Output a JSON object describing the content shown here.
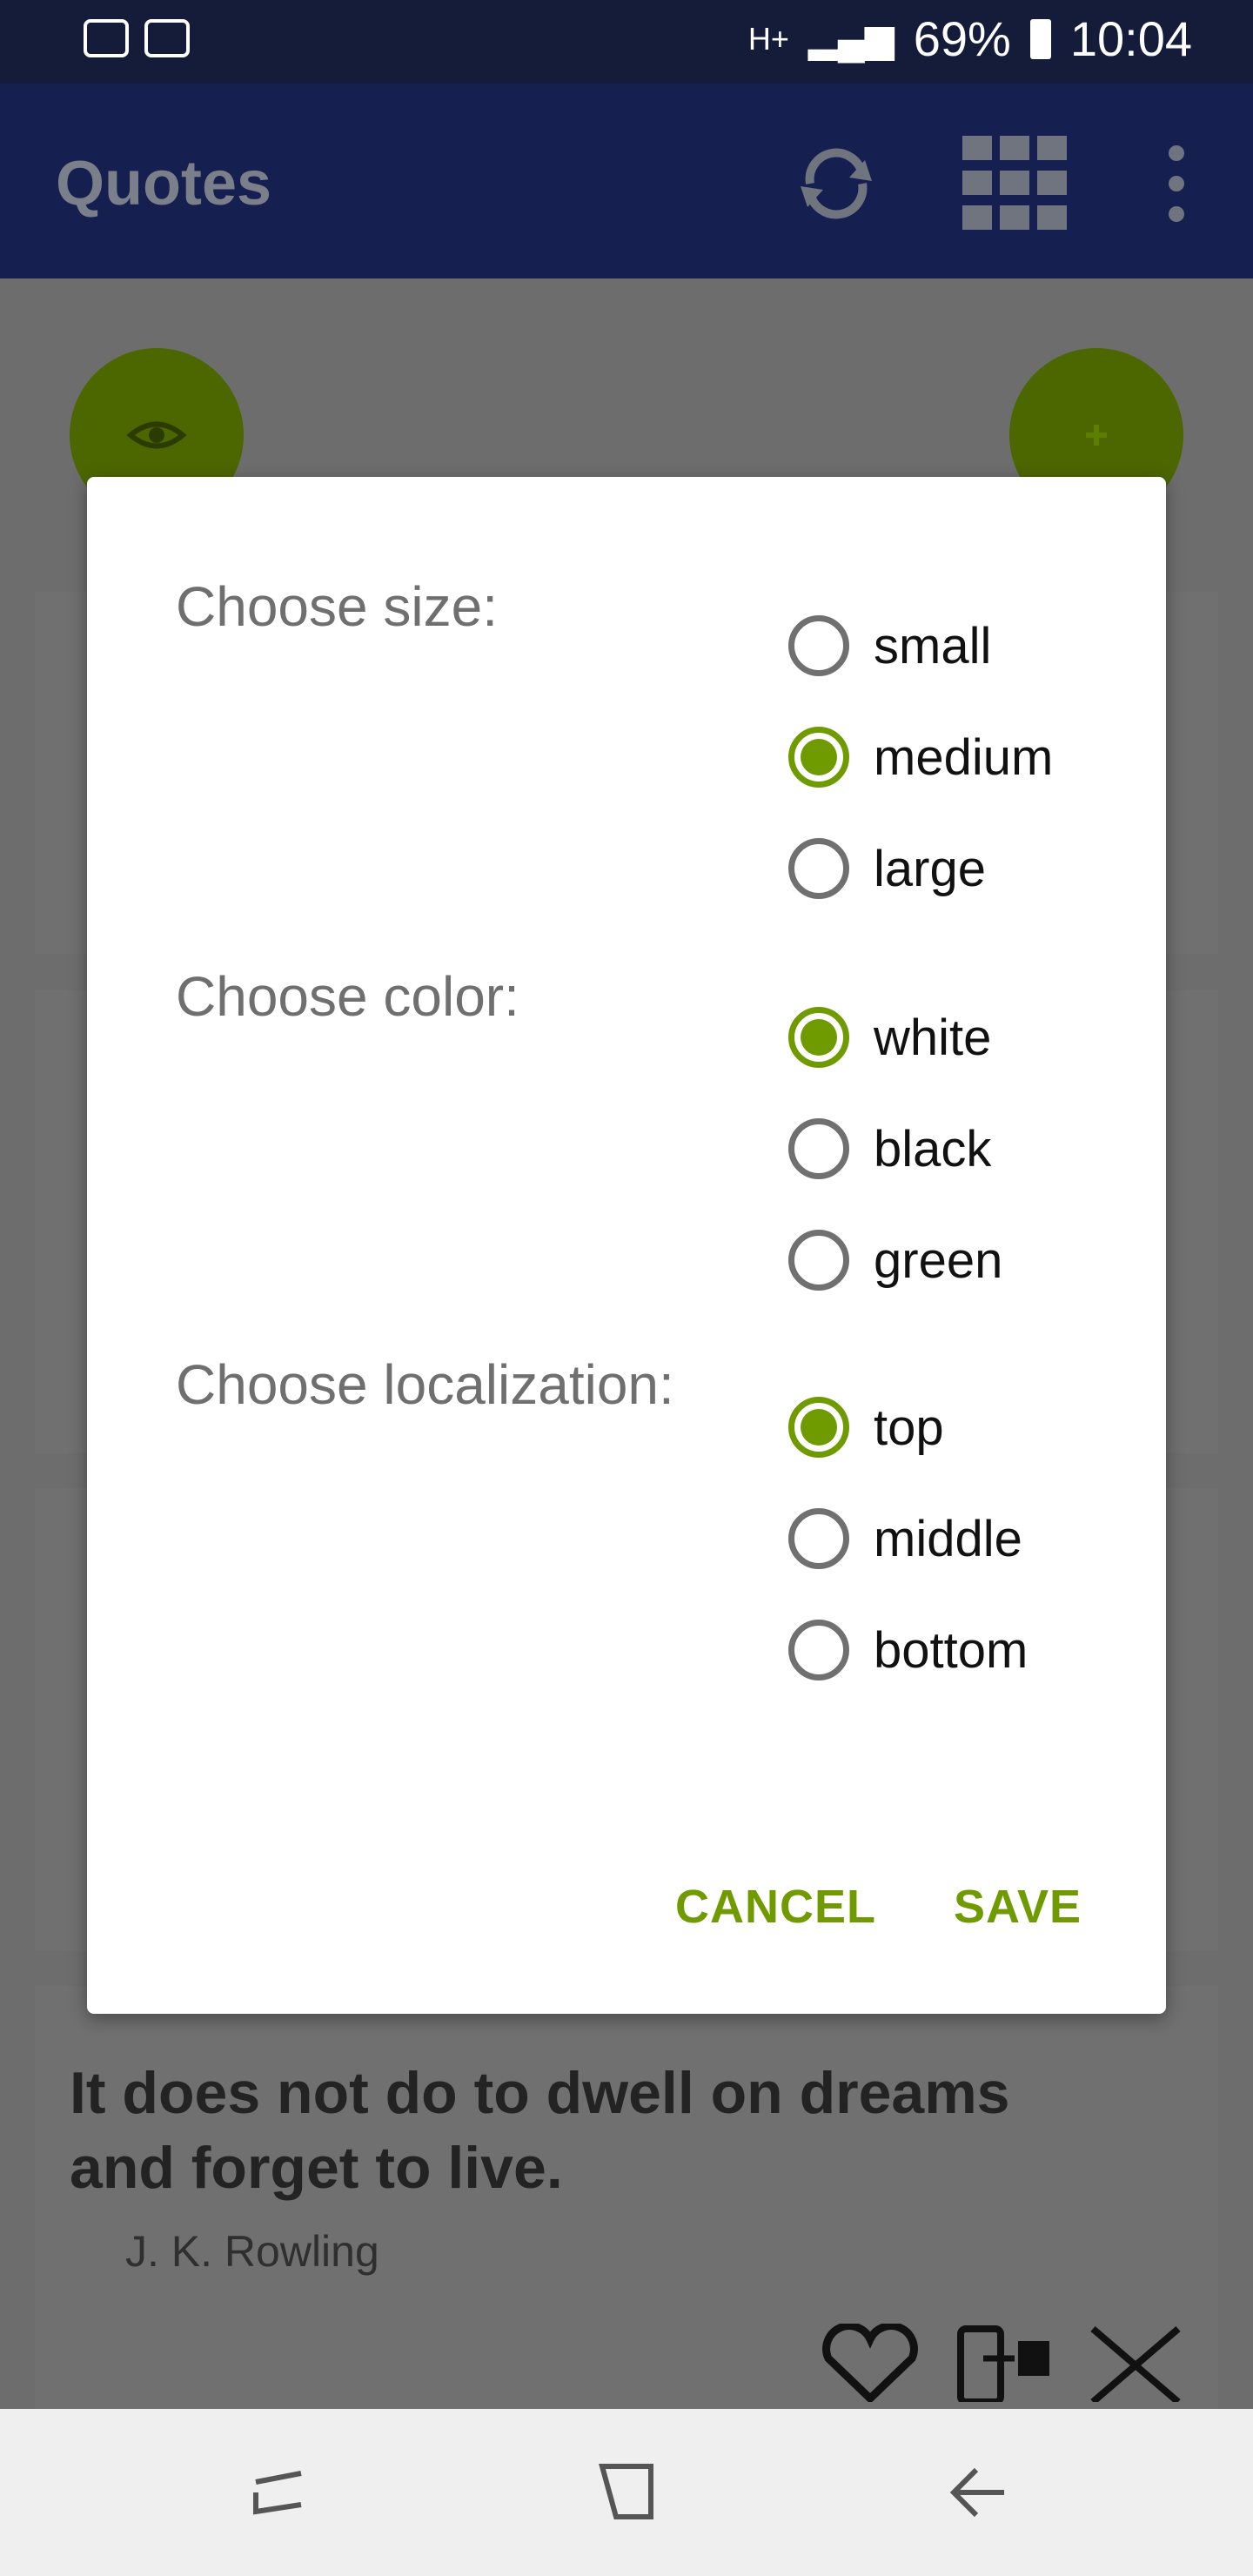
{
  "status": {
    "signal_label": "H+",
    "battery": "69%",
    "time": "10:04"
  },
  "appbar": {
    "title": "Quotes"
  },
  "quote": {
    "text": "It does not do to dwell on dreams and forget to live.",
    "author": "J. K. Rowling"
  },
  "dialog": {
    "size_label": "Choose size:",
    "size_options": [
      "small",
      "medium",
      "large"
    ],
    "size_selected": "medium",
    "color_label": "Choose color:",
    "color_options": [
      "white",
      "black",
      "green"
    ],
    "color_selected": "white",
    "loc_label": "Choose localization:",
    "loc_options": [
      "top",
      "middle",
      "bottom"
    ],
    "loc_selected": "top",
    "cancel": "CANCEL",
    "save": "SAVE"
  },
  "colors": {
    "accent": "#6f9b00",
    "appbar": "#152050",
    "statusbar": "#141c3a",
    "scrim": "#6d6d6d"
  }
}
